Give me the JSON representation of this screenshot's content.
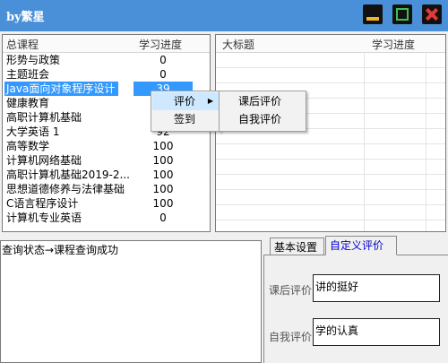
{
  "window": {
    "title": "by繁星"
  },
  "courses": {
    "header": {
      "name": "总课程",
      "progress": "学习进度"
    },
    "rows": [
      {
        "name": "形势与政策",
        "progress": "0"
      },
      {
        "name": "主题班会",
        "progress": "0"
      },
      {
        "name": "Java面向对象程序设计",
        "progress": "39"
      },
      {
        "name": "健康教育",
        "progress": ""
      },
      {
        "name": "高职计算机基础",
        "progress": ""
      },
      {
        "name": "大学英语 1",
        "progress": "92"
      },
      {
        "name": "高等数学",
        "progress": "100"
      },
      {
        "name": "计算机网络基础",
        "progress": "100"
      },
      {
        "name": "高职计算机基础2019-2...",
        "progress": "100"
      },
      {
        "name": "思想道德修养与法律基础",
        "progress": "100"
      },
      {
        "name": "C语言程序设计",
        "progress": "100"
      },
      {
        "name": "计算机专业英语",
        "progress": "0"
      }
    ]
  },
  "topics": {
    "header": {
      "title": "大标题",
      "progress": "学习进度"
    }
  },
  "context_menu": {
    "items": [
      {
        "label": "评价",
        "has_submenu": true
      },
      {
        "label": "签到",
        "has_submenu": false
      }
    ],
    "submenu": [
      {
        "label": "课后评价"
      },
      {
        "label": "自我评价"
      }
    ],
    "arrow_icon": "triangle-right-icon"
  },
  "status": {
    "text": "查询状态→课程查询成功"
  },
  "tabs": [
    {
      "label": "基本设置",
      "active": false
    },
    {
      "label": "自定义评价",
      "active": true
    }
  ],
  "evaluation": {
    "after_class_label": "课后评价",
    "after_class_value": "讲的挺好",
    "self_label": "自我评价",
    "self_value": "学的认真"
  },
  "colors": {
    "titlebar": "#4A90D9",
    "selection": "#3399FF",
    "active_tab_text": "#0000CC",
    "minimize": "#F0B429",
    "maximize": "#3FBF4F",
    "close": "#E53935"
  }
}
